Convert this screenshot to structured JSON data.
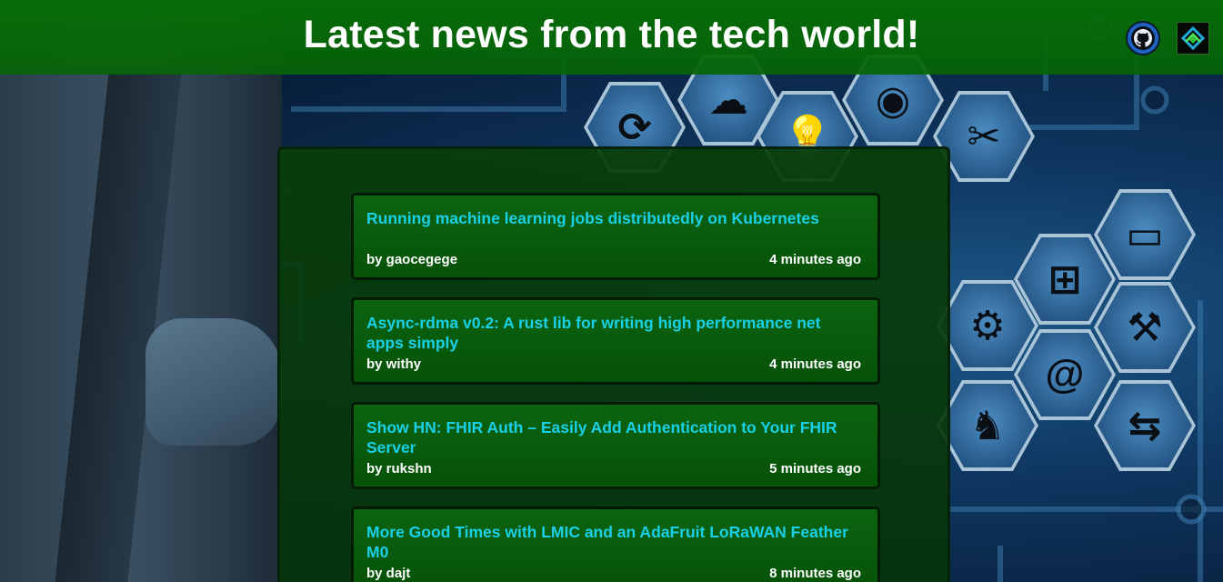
{
  "header": {
    "title": "Latest news from the tech world!",
    "github_icon": "github-icon",
    "project_icon": "project-logo-icon"
  },
  "background": {
    "icons": [
      "refresh-icon",
      "cloud-icon",
      "lightbulb-icon",
      "wifi-icon",
      "tools-icon",
      "monitor-icon",
      "network-icon",
      "brain-gears-icon",
      "robot-arm-icon",
      "at-icon",
      "robot-icon",
      "handshake-icon"
    ]
  },
  "news": [
    {
      "title": "Running machine learning jobs distributedly on Kubernetes",
      "author": "by gaocegege",
      "time": "4 minutes ago"
    },
    {
      "title": "Async-rdma v0.2: A rust lib for writing high performance net apps simply",
      "author": "by withy",
      "time": "4 minutes ago"
    },
    {
      "title": "Show HN: FHIR Auth – Easily Add Authentication to Your FHIR Server",
      "author": "by rukshn",
      "time": "5 minutes ago"
    },
    {
      "title": "More Good Times with LMIC and an AdaFruit LoRaWAN Feather M0",
      "author": "by dajt",
      "time": "8 minutes ago"
    }
  ],
  "colors": {
    "header_bg": "#066e06",
    "panel_bg": "#083e08",
    "link": "#1ad0e6",
    "text": "#ffffff"
  }
}
